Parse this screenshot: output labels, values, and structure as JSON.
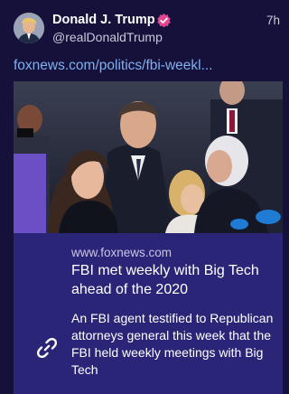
{
  "post": {
    "author_name": "Donald J. Trump",
    "author_handle": "@realDonaldTrump",
    "timestamp": "7h",
    "link_text": "foxnews.com/politics/fbi-weekl...",
    "verified_badge_icon": "verified-badge-icon",
    "avatar_icon": "avatar"
  },
  "card": {
    "domain": "www.foxnews.com",
    "title": "FBI met weekly with Big Tech ahead of the 2020",
    "summary": "An FBI agent testified to Republican attorneys general this week that the FBI held weekly meetings with Big Tech",
    "link_icon": "link-icon"
  },
  "colors": {
    "background": "#15113a",
    "card_background": "#2a2576",
    "link": "#7fb0f0",
    "badge": "#e3468f"
  }
}
